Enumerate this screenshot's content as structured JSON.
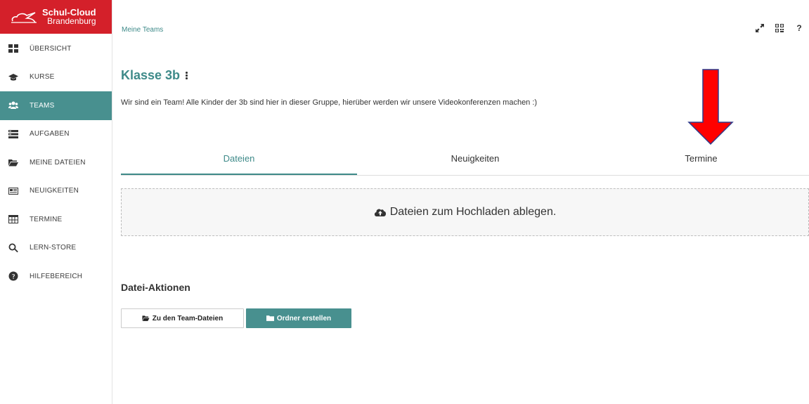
{
  "logo": {
    "title": "Schul-Cloud",
    "subtitle": "Brandenburg"
  },
  "sidebar": {
    "items": [
      {
        "label": "ÜBERSICHT",
        "icon": "dashboard-icon",
        "active": false
      },
      {
        "label": "KURSE",
        "icon": "graduation-cap-icon",
        "active": false
      },
      {
        "label": "TEAMS",
        "icon": "users-icon",
        "active": true
      },
      {
        "label": "AUFGABEN",
        "icon": "tasks-icon",
        "active": false
      },
      {
        "label": "MEINE DATEIEN",
        "icon": "folder-open-icon",
        "active": false
      },
      {
        "label": "NEUIGKEITEN",
        "icon": "newspaper-icon",
        "active": false
      },
      {
        "label": "TERMINE",
        "icon": "calendar-icon",
        "active": false
      },
      {
        "label": "LERN-STORE",
        "icon": "search-icon",
        "active": false
      },
      {
        "label": "HILFEBEREICH",
        "icon": "help-circle-icon",
        "active": false
      }
    ]
  },
  "header": {
    "breadcrumb": "Meine Teams",
    "help_label": "?"
  },
  "main": {
    "title": "Klasse 3b",
    "description": "Wir sind ein Team! Alle Kinder der 3b sind hier in dieser Gruppe, hierüber werden wir unsere Videokonferenzen machen :)",
    "tabs": [
      {
        "label": "Dateien",
        "active": true
      },
      {
        "label": "Neuigkeiten",
        "active": false
      },
      {
        "label": "Termine",
        "active": false
      }
    ],
    "dropzone_label": "Dateien zum Hochladen ablegen.",
    "file_actions_title": "Datei-Aktionen",
    "buttons": {
      "team_files": "Zu den Team-Dateien",
      "create_folder": "Ordner erstellen"
    }
  },
  "colors": {
    "accent": "#48908f",
    "brand": "#d4202a",
    "annotation_arrow": "#ff0000"
  }
}
